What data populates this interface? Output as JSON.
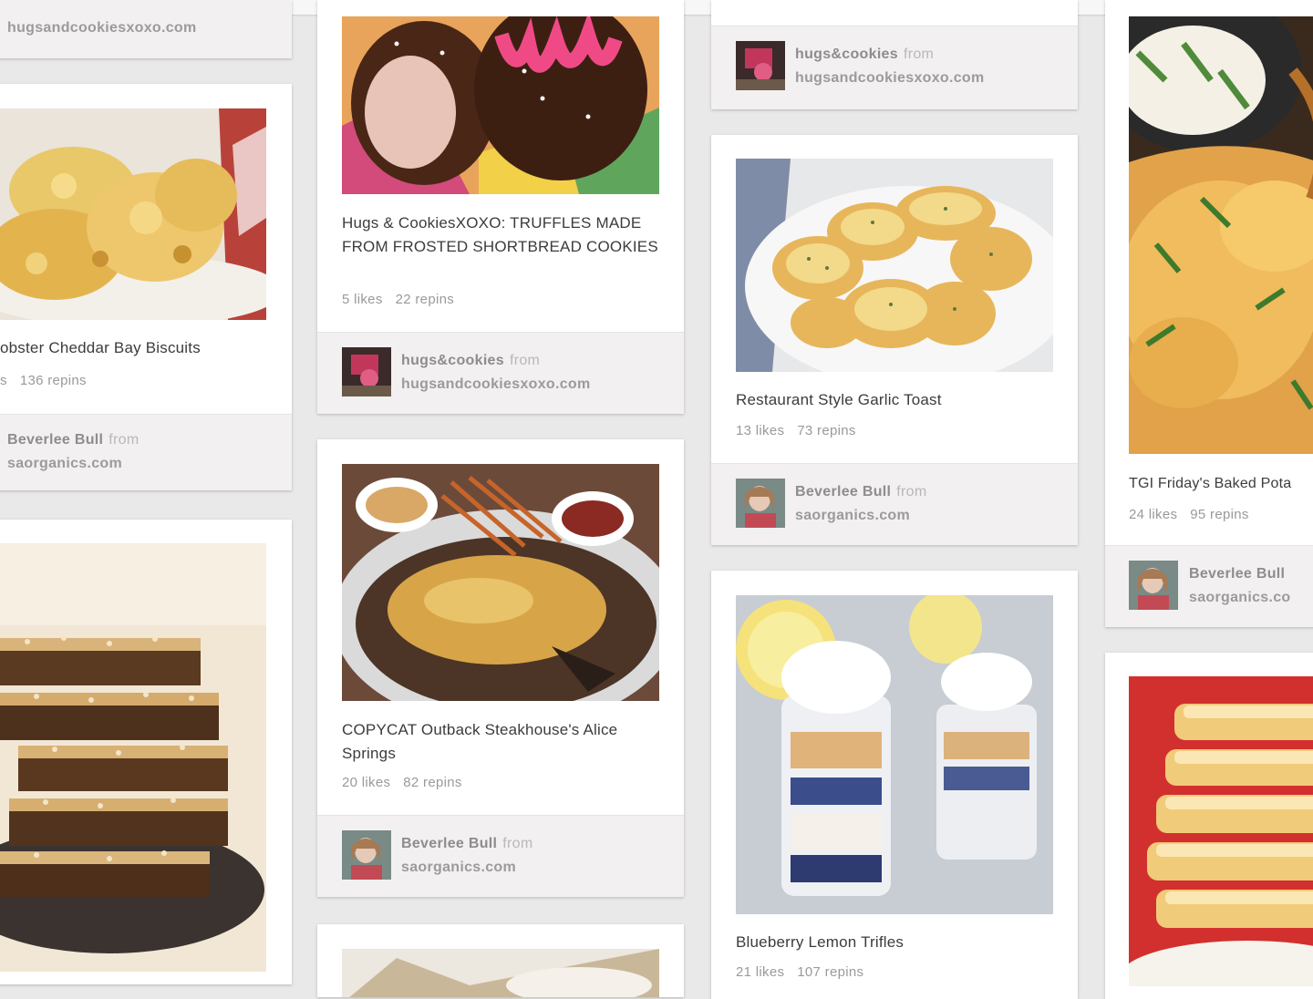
{
  "colors": {
    "page_bg": "#e9e9e9",
    "card_bg": "#ffffff",
    "footer_bg": "#f2f0f0"
  },
  "pins": {
    "c1_top": {
      "source": "hugsandcookiesxoxo.com"
    },
    "biscuits": {
      "description": "obster Cheddar Bay Biscuits",
      "likes": "s",
      "repins": "136 repins",
      "user": "Beverlee Bull",
      "from": "from",
      "source": "saorganics.com",
      "avatar_icon": "user-avatar-icon"
    },
    "truffles": {
      "description": "Hugs & CookiesXOXO: TRUFFLES MADE FROM FROSTED SHORTBREAD COOKIES",
      "likes": "5 likes",
      "repins": "22 repins",
      "user": "hugs&cookies",
      "from": "from",
      "source": "hugsandcookiesxoxo.com"
    },
    "alice": {
      "description": "COPYCAT Outback Steakhouse's Alice Springs",
      "likes": "20 likes",
      "repins": "82 repins",
      "user": "Beverlee Bull",
      "from": "from",
      "source": "saorganics.com"
    },
    "c3_top": {
      "user": "hugs&cookies",
      "from": "from",
      "source": "hugsandcookiesxoxo.com"
    },
    "garlic": {
      "description": "Restaurant Style Garlic Toast",
      "likes": "13 likes",
      "repins": "73 repins",
      "user": "Beverlee Bull",
      "from": "from",
      "source": "saorganics.com"
    },
    "trifles": {
      "description": "Blueberry Lemon Trifles",
      "likes": "21 likes",
      "repins": "107 repins"
    },
    "potato": {
      "description": "TGI Friday's Baked Pota",
      "likes": "24 likes",
      "repins": "95 repins",
      "user": "Beverlee Bull",
      "source": "saorganics.co"
    }
  }
}
